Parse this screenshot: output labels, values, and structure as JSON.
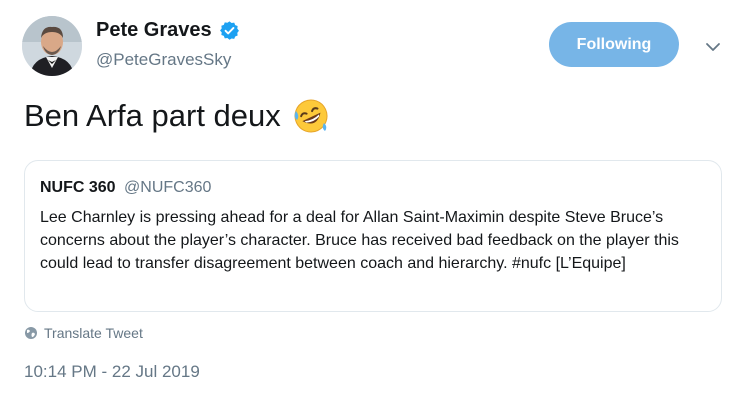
{
  "author": {
    "display_name": "Pete Graves",
    "handle": "@PeteGravesSky"
  },
  "follow_button": {
    "label": "Following"
  },
  "tweet": {
    "text": "Ben Arfa part deux",
    "emoji": "rolling-on-the-floor-laughing"
  },
  "quoted_tweet": {
    "display_name": "NUFC 360",
    "handle": "@NUFC360",
    "text": "Lee Charnley is pressing ahead for a deal for Allan Saint-Maximin despite Steve Bruce’s concerns about the player’s character. Bruce has received bad feedback on the player this could lead to transfer disagreement between coach and hierarchy. #nufc [L’Equipe]"
  },
  "translate_label": "Translate Tweet",
  "timestamp": "10:14 PM - 22 Jul 2019",
  "colors": {
    "accent": "#1da1f2",
    "follow_button_bg": "#77b5e7",
    "secondary_text": "#657786",
    "border": "#e1e8ed"
  }
}
